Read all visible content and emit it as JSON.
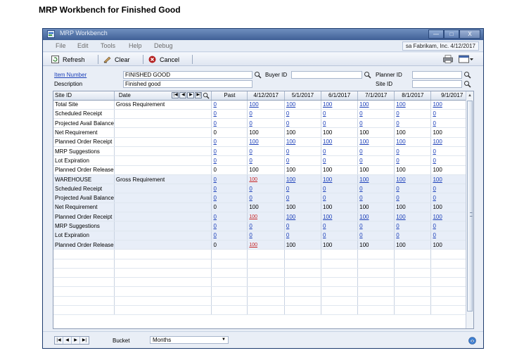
{
  "document_title": "MRP Workbench for Finished Good",
  "window": {
    "title": "MRP Workbench",
    "controls": {
      "minimize": "—",
      "maximize": "□",
      "close": "X"
    }
  },
  "menu": {
    "file": "File",
    "edit": "Edit",
    "tools": "Tools",
    "help": "Help",
    "debug": "Debug"
  },
  "user_info": "sa  Fabrikam, Inc.  4/12/2017",
  "toolbar": {
    "refresh": "Refresh",
    "clear": "Clear",
    "cancel": "Cancel"
  },
  "header": {
    "item_number_label": "Item Number",
    "item_number_value": "FINISHED GOOD",
    "description_label": "Description",
    "description_value": "Finished good",
    "buyer_id_label": "Buyer ID",
    "buyer_id_value": "",
    "planner_id_label": "Planner ID",
    "planner_id_value": "",
    "site_id_label": "Site ID",
    "site_id_value": ""
  },
  "grid": {
    "columns": {
      "site_id": "Site ID",
      "date": "Date",
      "past": "Past",
      "d1": "4/12/2017",
      "d2": "5/1/2017",
      "d3": "6/1/2017",
      "d4": "7/1/2017",
      "d5": "8/1/2017",
      "d6": "9/1/2017"
    },
    "nav_buttons": [
      "|◀",
      "◀",
      "▶",
      "▶|"
    ],
    "rows": [
      {
        "site": "Total Site",
        "label": "Gross Requirement",
        "past": "0",
        "values": [
          "100",
          "100",
          "100",
          "100",
          "100",
          "100"
        ],
        "link": true,
        "red": false,
        "blue": false
      },
      {
        "site": "Scheduled Receipt",
        "label": "",
        "past": "0",
        "values": [
          "0",
          "0",
          "0",
          "0",
          "0",
          "0"
        ],
        "link": true,
        "red": false,
        "blue": false
      },
      {
        "site": "Projected Avail Balance",
        "label": "",
        "past": "0",
        "values": [
          "0",
          "0",
          "0",
          "0",
          "0",
          "0"
        ],
        "link": true,
        "red": false,
        "blue": false
      },
      {
        "site": "Net Requirement",
        "label": "",
        "past": "0",
        "values": [
          "100",
          "100",
          "100",
          "100",
          "100",
          "100"
        ],
        "link": false,
        "red": false,
        "blue": false
      },
      {
        "site": "Planned Order Receipt",
        "label": "",
        "past": "0",
        "values": [
          "100",
          "100",
          "100",
          "100",
          "100",
          "100"
        ],
        "link": true,
        "red": false,
        "blue": false
      },
      {
        "site": "MRP Suggestions",
        "label": "",
        "past": "0",
        "values": [
          "0",
          "0",
          "0",
          "0",
          "0",
          "0"
        ],
        "link": true,
        "red": false,
        "blue": false
      },
      {
        "site": "Lot Expiration",
        "label": "",
        "past": "0",
        "values": [
          "0",
          "0",
          "0",
          "0",
          "0",
          "0"
        ],
        "link": true,
        "red": false,
        "blue": false
      },
      {
        "site": "Planned Order Release",
        "label": "",
        "past": "0",
        "values": [
          "100",
          "100",
          "100",
          "100",
          "100",
          "100"
        ],
        "link": false,
        "red": false,
        "blue": false
      },
      {
        "site": "WAREHOUSE",
        "label": "Gross Requirement",
        "past": "0",
        "values": [
          "100",
          "100",
          "100",
          "100",
          "100",
          "100"
        ],
        "link": true,
        "red": true,
        "blue": true
      },
      {
        "site": "Scheduled Receipt",
        "label": "",
        "past": "0",
        "values": [
          "0",
          "0",
          "0",
          "0",
          "0",
          "0"
        ],
        "link": true,
        "red": false,
        "blue": true
      },
      {
        "site": "Projected Avail Balance",
        "label": "",
        "past": "0",
        "values": [
          "0",
          "0",
          "0",
          "0",
          "0",
          "0"
        ],
        "link": true,
        "red": false,
        "blue": true
      },
      {
        "site": "Net Requirement",
        "label": "",
        "past": "0",
        "values": [
          "100",
          "100",
          "100",
          "100",
          "100",
          "100"
        ],
        "link": false,
        "red": false,
        "blue": true
      },
      {
        "site": "Planned Order Receipt",
        "label": "",
        "past": "0",
        "values": [
          "100",
          "100",
          "100",
          "100",
          "100",
          "100"
        ],
        "link": true,
        "red": true,
        "blue": true
      },
      {
        "site": "MRP Suggestions",
        "label": "",
        "past": "0",
        "values": [
          "0",
          "0",
          "0",
          "0",
          "0",
          "0"
        ],
        "link": true,
        "red": false,
        "blue": true
      },
      {
        "site": "Lot Expiration",
        "label": "",
        "past": "0",
        "values": [
          "0",
          "0",
          "0",
          "0",
          "0",
          "0"
        ],
        "link": true,
        "red": false,
        "blue": true
      },
      {
        "site": "Planned Order Release",
        "label": "",
        "past": "0",
        "values": [
          "100",
          "100",
          "100",
          "100",
          "100",
          "100"
        ],
        "link": false,
        "red": true,
        "blue": true
      }
    ],
    "empty_rows": 7
  },
  "footer": {
    "record_nav": [
      "|◀",
      "◀",
      "▶",
      "▶|"
    ],
    "bucket_label": "Bucket",
    "bucket_value": "Months"
  },
  "colors": {
    "title_bar": "#4f6fa6",
    "link": "#1b3fb8",
    "red_value": "#c62424",
    "site_band": "#e8eef8"
  },
  "icons": [
    "app-icon",
    "refresh-icon",
    "clear-icon",
    "cancel-icon",
    "print-icon",
    "window-list-icon",
    "lookup-icon",
    "help-icon"
  ]
}
